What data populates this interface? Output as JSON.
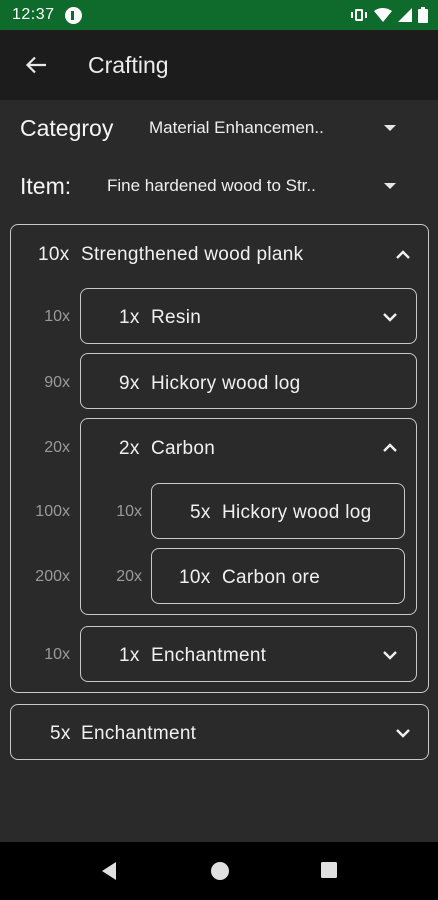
{
  "status_bar": {
    "time": "12:37"
  },
  "app_bar": {
    "title": "Crafting"
  },
  "category": {
    "label": "Categroy",
    "value": "Material Enhancemen.."
  },
  "item": {
    "label": "Item:",
    "value": "Fine hardened wood to Str.."
  },
  "recipe": {
    "root": {
      "qty": "10x",
      "name": "Strengthened wood plank"
    },
    "children": [
      {
        "total": "10x",
        "qty": "1x",
        "name": "Resin"
      },
      {
        "total": "90x",
        "qty": "9x",
        "name": "Hickory wood log"
      },
      {
        "total": "20x",
        "qty": "2x",
        "name": "Carbon",
        "children": [
          {
            "total": "100x",
            "sub_total": "10x",
            "qty": "5x",
            "name": "Hickory wood log"
          },
          {
            "total": "200x",
            "sub_total": "20x",
            "qty": "10x",
            "name": "Carbon ore"
          }
        ]
      },
      {
        "total": "10x",
        "qty": "1x",
        "name": "Enchantment"
      }
    ],
    "second_root": {
      "qty": "5x",
      "name": "Enchantment"
    }
  },
  "colors": {
    "status_bar": "#0f6b2c",
    "background": "#2a2a2a",
    "card_border": "#c9c9c9",
    "multiplier_text": "#9a9a9a"
  }
}
